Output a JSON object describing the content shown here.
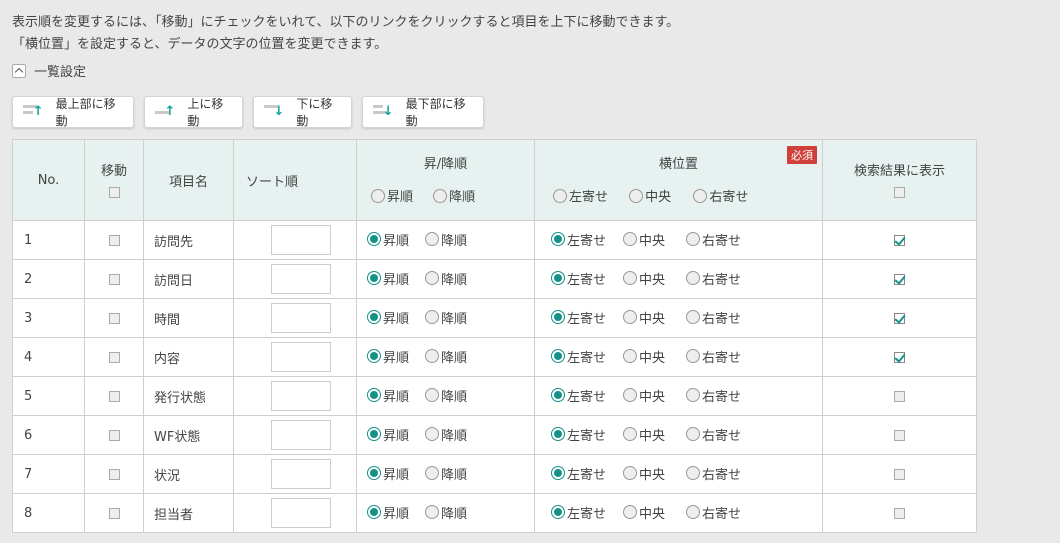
{
  "description": {
    "line1": "表示順を変更するには、「移動」にチェックをいれて、以下のリンクをクリックすると項目を上下に移動できます。",
    "line2": "「横位置」を設定すると、データの文字の位置を変更できます。"
  },
  "toggle_label": "一覧設定",
  "buttons": {
    "top": "最上部に移動",
    "up": "上に移動",
    "down": "下に移動",
    "bottom": "最下部に移動"
  },
  "headers": {
    "no": "No.",
    "move": "移動",
    "item": "項目名",
    "sort": "ソート順",
    "order": "昇/降順",
    "asc": "昇順",
    "desc": "降順",
    "position": "横位置",
    "required": "必須",
    "left": "左寄せ",
    "center": "中央",
    "right": "右寄せ",
    "show": "検索結果に表示"
  },
  "rows": [
    {
      "no": "1",
      "name": "訪問先",
      "order": "asc",
      "align": "left",
      "show": true
    },
    {
      "no": "2",
      "name": "訪問日",
      "order": "asc",
      "align": "left",
      "show": true
    },
    {
      "no": "3",
      "name": "時間",
      "order": "asc",
      "align": "left",
      "show": true
    },
    {
      "no": "4",
      "name": "内容",
      "order": "asc",
      "align": "left",
      "show": true
    },
    {
      "no": "5",
      "name": "発行状態",
      "order": "asc",
      "align": "left",
      "show": false
    },
    {
      "no": "6",
      "name": "WF状態",
      "order": "asc",
      "align": "left",
      "show": false
    },
    {
      "no": "7",
      "name": "状況",
      "order": "asc",
      "align": "left",
      "show": false
    },
    {
      "no": "8",
      "name": "担当者",
      "order": "asc",
      "align": "left",
      "show": false
    }
  ],
  "colors": {
    "accent": "#14928a",
    "required": "#d0403a",
    "header_bg": "#e6f1f0"
  }
}
